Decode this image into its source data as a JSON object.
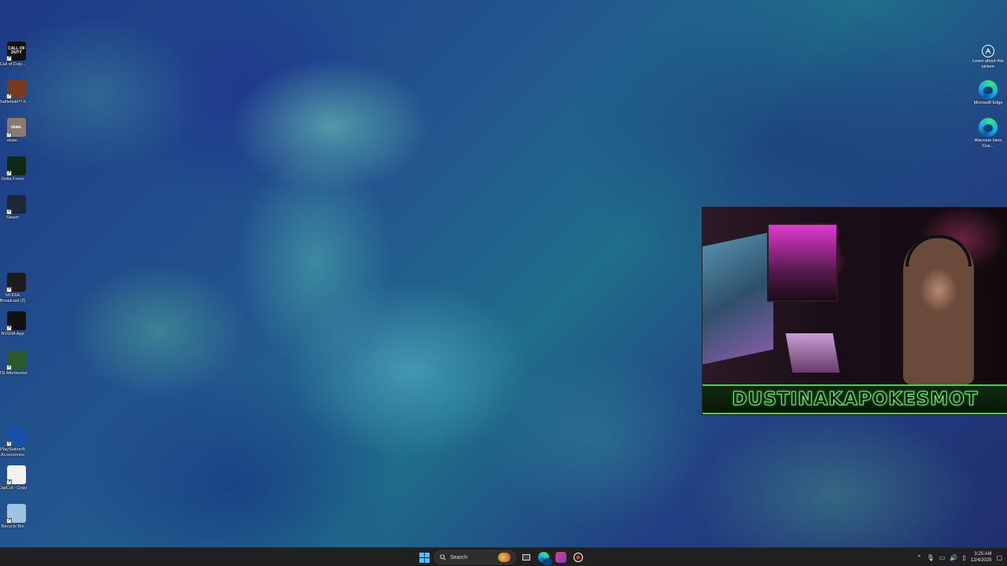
{
  "desktop": {
    "left_icons": [
      {
        "id": "cod",
        "label": "Call of Duty...",
        "icon": "call-of-duty-icon",
        "color": "#111111",
        "text": "CALL OF DUTY"
      },
      {
        "id": "bf6",
        "label": "Battlefield™ 6",
        "icon": "battlefield-6-icon",
        "color": "#7a3a20",
        "text": ""
      },
      {
        "id": "skate",
        "label": "skate.",
        "icon": "skate-icon",
        "color": "#8a7a70",
        "text": "skate."
      },
      {
        "id": "delta",
        "label": "Delta Force",
        "icon": "delta-force-icon",
        "color": "#0f2a14",
        "text": ""
      },
      {
        "id": "steam",
        "label": "Steam",
        "icon": "steam-icon",
        "color": "#1b2838",
        "text": ""
      },
      {
        "id": "nvbroadcast",
        "label": "NVIDIA Broadcast (2)",
        "icon": "nvidia-broadcast-icon",
        "color": "#1c1c1c",
        "text": ""
      },
      {
        "id": "nvapp",
        "label": "NVIDIA App",
        "icon": "nvidia-app-icon",
        "color": "#111111",
        "text": ""
      },
      {
        "id": "msi",
        "label": "MSI Afterburner",
        "icon": "msi-afterburner-icon",
        "color": "#2a5a2a",
        "text": ""
      },
      {
        "id": "ps",
        "label": "PlayStation® Accessories",
        "icon": "playstation-accessories-icon",
        "color": "#1a4fa8",
        "text": ""
      },
      {
        "id": "capcut",
        "label": "CapCut - Copy",
        "icon": "capcut-icon",
        "color": "#f2f2f2",
        "text": ""
      },
      {
        "id": "recycle",
        "label": "Recycle Bin",
        "icon": "recycle-bin-icon",
        "color": "#9fc4e0",
        "text": ""
      }
    ],
    "right_icons": [
      {
        "id": "learn",
        "label": "Learn about this picture",
        "icon": "learn-about-picture-icon"
      },
      {
        "id": "edge",
        "label": "Microsoft Edge",
        "icon": "edge-icon"
      },
      {
        "id": "warzone",
        "label": "Warzone Hero Dus...",
        "icon": "edge-icon"
      }
    ]
  },
  "webcam": {
    "banner_text": "DUSTINAKAPOKESMOT"
  },
  "taskbar": {
    "search_label": "Search",
    "time": "3:25 AM",
    "date": "12/4/2025"
  }
}
